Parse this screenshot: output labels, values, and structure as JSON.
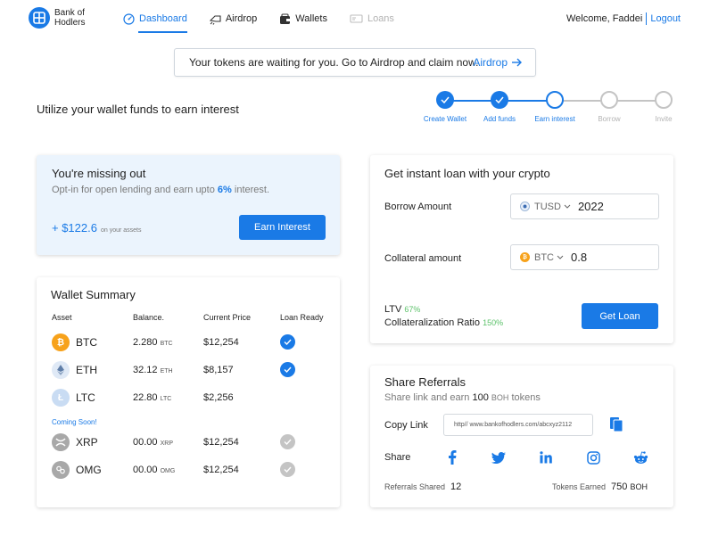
{
  "header": {
    "brand": {
      "line1": "Bank of",
      "line2": "Hodlers"
    },
    "nav": [
      {
        "label": "Dashboard",
        "icon": "dashboard-icon",
        "state": "active"
      },
      {
        "label": "Airdrop",
        "icon": "airdrop-icon",
        "state": "normal"
      },
      {
        "label": "Wallets",
        "icon": "wallet-icon",
        "state": "normal"
      },
      {
        "label": "Loans",
        "icon": "loans-icon",
        "state": "disabled"
      }
    ],
    "welcome": "Welcome, Faddei",
    "logout": "Logout"
  },
  "banner": {
    "text": "Your tokens are waiting for you. Go to Airdrop and claim now.",
    "link": "Airdrop"
  },
  "utilize_title": "Utilize your wallet funds to earn interest",
  "stepper": {
    "steps": [
      {
        "label": "Create Wallet",
        "state": "done"
      },
      {
        "label": "Add funds",
        "state": "done"
      },
      {
        "label": "Earn interest",
        "state": "current"
      },
      {
        "label": "Borrow",
        "state": "pending"
      },
      {
        "label": "Invite",
        "state": "pending"
      }
    ]
  },
  "missing": {
    "title": "You're missing out",
    "sub_prefix": "Opt-in for open lending and earn upto ",
    "sub_pct": "6%",
    "sub_suffix": " interest.",
    "amount": "+ $122.6",
    "amount_note": "on your assets",
    "button": "Earn Interest"
  },
  "loan": {
    "title": "Get instant loan with your crypto",
    "borrow_label": "Borrow Amount",
    "borrow_currency": "TUSD",
    "borrow_value": "2022",
    "collateral_label": "Collateral amount",
    "collateral_currency": "BTC",
    "collateral_value": "0.8",
    "ltv_label": "LTV",
    "ltv_value": "67%",
    "ratio_label": "Collateralization Ratio",
    "ratio_value": "150%",
    "button": "Get Loan"
  },
  "wallet": {
    "title": "Wallet Summary",
    "columns": [
      "Asset",
      "Balance.",
      "Current Price",
      "Loan Ready"
    ],
    "coming_soon": "Coming Soon!",
    "assets": [
      {
        "symbol": "BTC",
        "balance": "2.280",
        "unit": "BTC",
        "price": "$12,254",
        "loan_ready": true,
        "color": "#f7a21b",
        "glyph": "₿"
      },
      {
        "symbol": "ETH",
        "balance": "32.12",
        "unit": "ETH",
        "price": "$8,157",
        "loan_ready": true,
        "color": "#dfe9f6",
        "glyph": "◆"
      },
      {
        "symbol": "LTC",
        "balance": "22.80",
        "unit": "LTC",
        "price": "$2,256",
        "loan_ready": null,
        "color": "#c9dcf3",
        "glyph": "Ł"
      }
    ],
    "soon_assets": [
      {
        "symbol": "XRP",
        "balance": "00.00",
        "unit": "XRP",
        "price": "$12,254",
        "loan_ready": false,
        "color": "#a8a8a8",
        "glyph": "✕"
      },
      {
        "symbol": "OMG",
        "balance": "00.00",
        "unit": "OMG",
        "price": "$12,254",
        "loan_ready": false,
        "color": "#a8a8a8",
        "glyph": "∞"
      }
    ]
  },
  "referrals": {
    "title": "Share Referrals",
    "sub_prefix": "Share link and earn ",
    "sub_amount": "100",
    "sub_unit": "BOH",
    "sub_suffix": " tokens",
    "copy_label": "Copy Link",
    "link": "http// www.bankofhodlers.com/abcxyz2112",
    "share_label": "Share",
    "shared_label": "Referrals Shared",
    "shared_value": "12",
    "earned_label": "Tokens Earned",
    "earned_value": "750",
    "earned_unit": "BOH",
    "social": [
      "facebook-icon",
      "twitter-icon",
      "linkedin-icon",
      "instagram-icon",
      "reddit-icon"
    ]
  },
  "colors": {
    "accent": "#1a7ae6",
    "green": "#5cc26a",
    "muted": "#b3b3b3",
    "btc": "#f7a21b"
  }
}
